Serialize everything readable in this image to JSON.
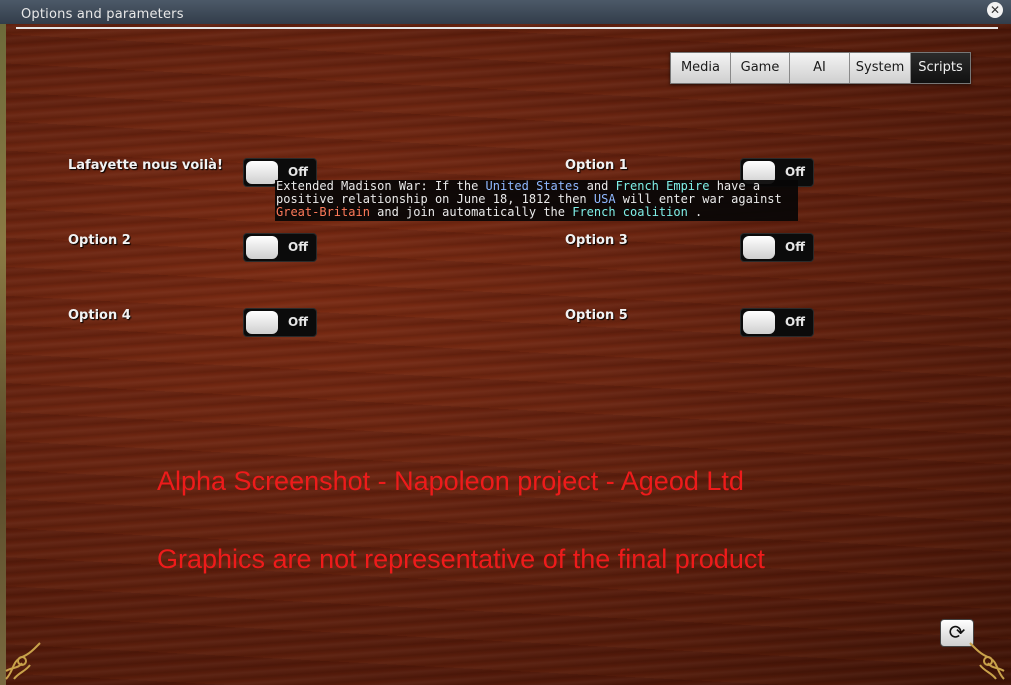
{
  "window": {
    "title": "Options and parameters",
    "close_symbol": "✕"
  },
  "tabs": [
    {
      "label": "Media",
      "active": false
    },
    {
      "label": "Game",
      "active": false
    },
    {
      "label": "AI",
      "active": false
    },
    {
      "label": "System",
      "active": false
    },
    {
      "label": "Scripts",
      "active": true
    }
  ],
  "options": [
    {
      "label": "Lafayette nous voilà!",
      "state": "Off"
    },
    {
      "label": "Option 1",
      "state": "Off"
    },
    {
      "label": "Option 2",
      "state": "Off"
    },
    {
      "label": "Option 3",
      "state": "Off"
    },
    {
      "label": "Option 4",
      "state": "Off"
    },
    {
      "label": "Option 5",
      "state": "Off"
    }
  ],
  "tooltip": {
    "p1": "Extended Madison War: If the ",
    "h1": "United States",
    "p2": " and ",
    "h2": "French Empire",
    "p3": " have a positive relationship on June 18, 1812 then ",
    "h3": "USA",
    "p4": " will enter war against ",
    "h4": "Great-Britain",
    "p5": " and join automatically the ",
    "h5": "French coalition",
    "p6": " ."
  },
  "watermark": {
    "line1": "Alpha Screenshot - Napoleon project - Ageod Ltd",
    "line2": "Graphics are not representative of the final product"
  },
  "refresh_icon": "⟳",
  "colors": {
    "watermark": "#ee1b1b",
    "tooltip_country_blue": "#8fb8ff",
    "tooltip_country_cyan": "#7ff0e8",
    "tooltip_country_red": "#ff7a5a"
  }
}
